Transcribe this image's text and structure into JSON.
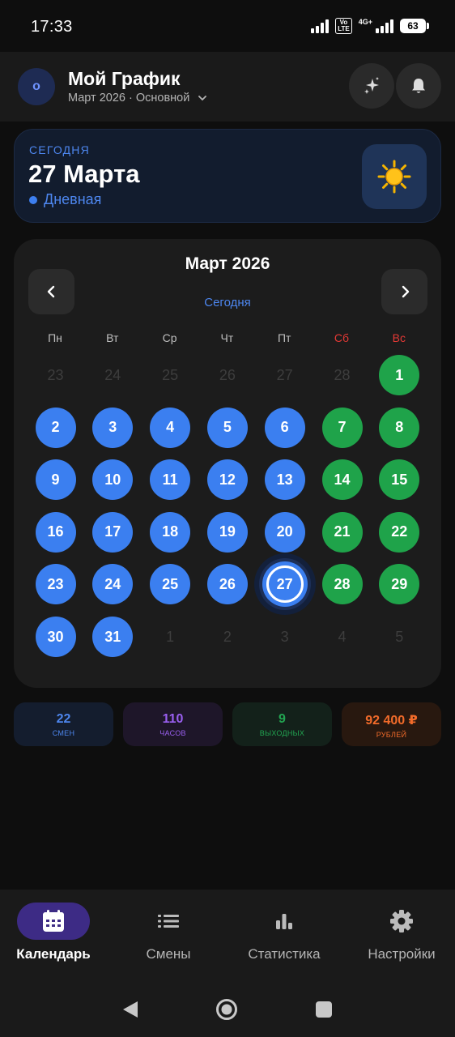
{
  "status_bar": {
    "time": "17:33",
    "network_badge": "Vo LTE",
    "network_type": "4G+",
    "battery": "63"
  },
  "header": {
    "avatar_letter": "о",
    "title": "Мой График",
    "subtitle": "Март 2026 · Основной",
    "chevron_icon": "chevron-down-icon",
    "action_icons": [
      "sparkles-icon",
      "bell-icon"
    ]
  },
  "today": {
    "label": "СЕГОДНЯ",
    "date": "27 Марта",
    "shift": "Дневная",
    "shift_color": "#3b7ff0",
    "icon": "sun-icon"
  },
  "calendar": {
    "title": "Март 2026",
    "today_link": "Сегодня",
    "prev_icon": "chevron-left-icon",
    "next_icon": "chevron-right-icon",
    "weekdays": [
      "Пн",
      "Вт",
      "Ср",
      "Чт",
      "Пт",
      "Сб",
      "Вс"
    ],
    "colors": {
      "work_day": "#3b7ff0",
      "day_off": "#1fa34a",
      "weekend_header": "#e53935"
    },
    "weeks": [
      [
        {
          "d": "23",
          "t": "muted"
        },
        {
          "d": "24",
          "t": "muted"
        },
        {
          "d": "25",
          "t": "muted"
        },
        {
          "d": "26",
          "t": "muted"
        },
        {
          "d": "27",
          "t": "muted"
        },
        {
          "d": "28",
          "t": "muted"
        },
        {
          "d": "1",
          "t": "green"
        }
      ],
      [
        {
          "d": "2",
          "t": "blue"
        },
        {
          "d": "3",
          "t": "blue"
        },
        {
          "d": "4",
          "t": "blue"
        },
        {
          "d": "5",
          "t": "blue"
        },
        {
          "d": "6",
          "t": "blue"
        },
        {
          "d": "7",
          "t": "green"
        },
        {
          "d": "8",
          "t": "green"
        }
      ],
      [
        {
          "d": "9",
          "t": "blue"
        },
        {
          "d": "10",
          "t": "blue"
        },
        {
          "d": "11",
          "t": "blue"
        },
        {
          "d": "12",
          "t": "blue"
        },
        {
          "d": "13",
          "t": "blue"
        },
        {
          "d": "14",
          "t": "green"
        },
        {
          "d": "15",
          "t": "green"
        }
      ],
      [
        {
          "d": "16",
          "t": "blue"
        },
        {
          "d": "17",
          "t": "blue"
        },
        {
          "d": "18",
          "t": "blue"
        },
        {
          "d": "19",
          "t": "blue"
        },
        {
          "d": "20",
          "t": "blue"
        },
        {
          "d": "21",
          "t": "green"
        },
        {
          "d": "22",
          "t": "green"
        }
      ],
      [
        {
          "d": "23",
          "t": "blue"
        },
        {
          "d": "24",
          "t": "blue"
        },
        {
          "d": "25",
          "t": "blue"
        },
        {
          "d": "26",
          "t": "blue"
        },
        {
          "d": "27",
          "t": "today"
        },
        {
          "d": "28",
          "t": "green"
        },
        {
          "d": "29",
          "t": "green"
        }
      ],
      [
        {
          "d": "30",
          "t": "blue"
        },
        {
          "d": "31",
          "t": "blue"
        },
        {
          "d": "1",
          "t": "muted"
        },
        {
          "d": "2",
          "t": "muted"
        },
        {
          "d": "3",
          "t": "muted"
        },
        {
          "d": "4",
          "t": "muted"
        },
        {
          "d": "5",
          "t": "muted"
        }
      ]
    ]
  },
  "stats": [
    {
      "value": "22",
      "label": "СМЕН",
      "color": "#4d86ee",
      "bg": "#141d2e"
    },
    {
      "value": "110",
      "label": "ЧАСОВ",
      "color": "#9a5ff0",
      "bg": "#1e1629"
    },
    {
      "value": "9",
      "label": "ВЫХОДНЫХ",
      "color": "#22a551",
      "bg": "#13211a"
    },
    {
      "value": "92 400 ₽",
      "label": "РУБЛЕЙ",
      "color": "#f26b2a",
      "bg": "#28180f"
    }
  ],
  "bottom_nav": [
    {
      "label": "Календарь",
      "icon": "calendar-icon",
      "active": true
    },
    {
      "label": "Смены",
      "icon": "list-icon",
      "active": false
    },
    {
      "label": "Статистика",
      "icon": "bar-chart-icon",
      "active": false
    },
    {
      "label": "Настройки",
      "icon": "gear-icon",
      "active": false
    }
  ],
  "system_nav": [
    "back-icon",
    "home-icon",
    "recents-icon"
  ]
}
